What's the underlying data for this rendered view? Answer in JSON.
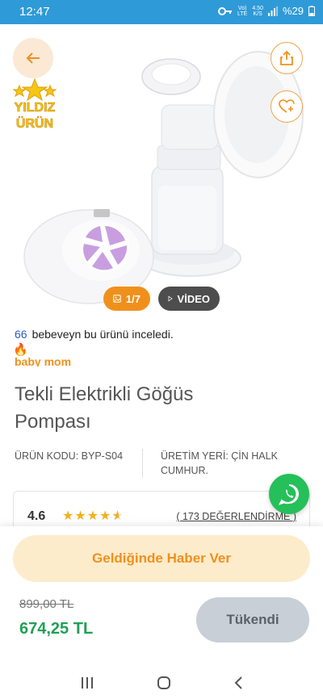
{
  "status": {
    "time": "12:47",
    "volte_top": "Vo)",
    "volte_bottom": "LTE",
    "net_top": "4.50",
    "net_bottom": "K/S",
    "battery": "%29"
  },
  "hero": {
    "badge_line1": "YILDIZ",
    "badge_line2": "ÜRÜN",
    "photo_counter": "1/7",
    "video_label": "VİDEO"
  },
  "product": {
    "review_count": "66",
    "review_text": "bebeveyn bu ürünü inceledi.",
    "fire_icon": "🔥",
    "brand": "baby mom",
    "title": "Tekli Elektrikli Göğüs Pompası",
    "code_label": "ÜRÜN KODU: BYP-S04",
    "origin_label": "ÜRETİM YERİ: ÇİN HALK CUMHUR.",
    "rating": "4.6",
    "rating_stars": 4.6,
    "rating_link": "( 173 DEĞERLENDİRME )"
  },
  "actions": {
    "notify_label": "Geldiğinde Haber Ver",
    "old_price": "899,00 TL",
    "new_price": "674,25 TL",
    "soldout_label": "Tükendi"
  },
  "colors": {
    "accent": "#f0901c",
    "price": "#1fa055",
    "status_bar": "#2f9ad8",
    "whatsapp": "#25c05a"
  }
}
